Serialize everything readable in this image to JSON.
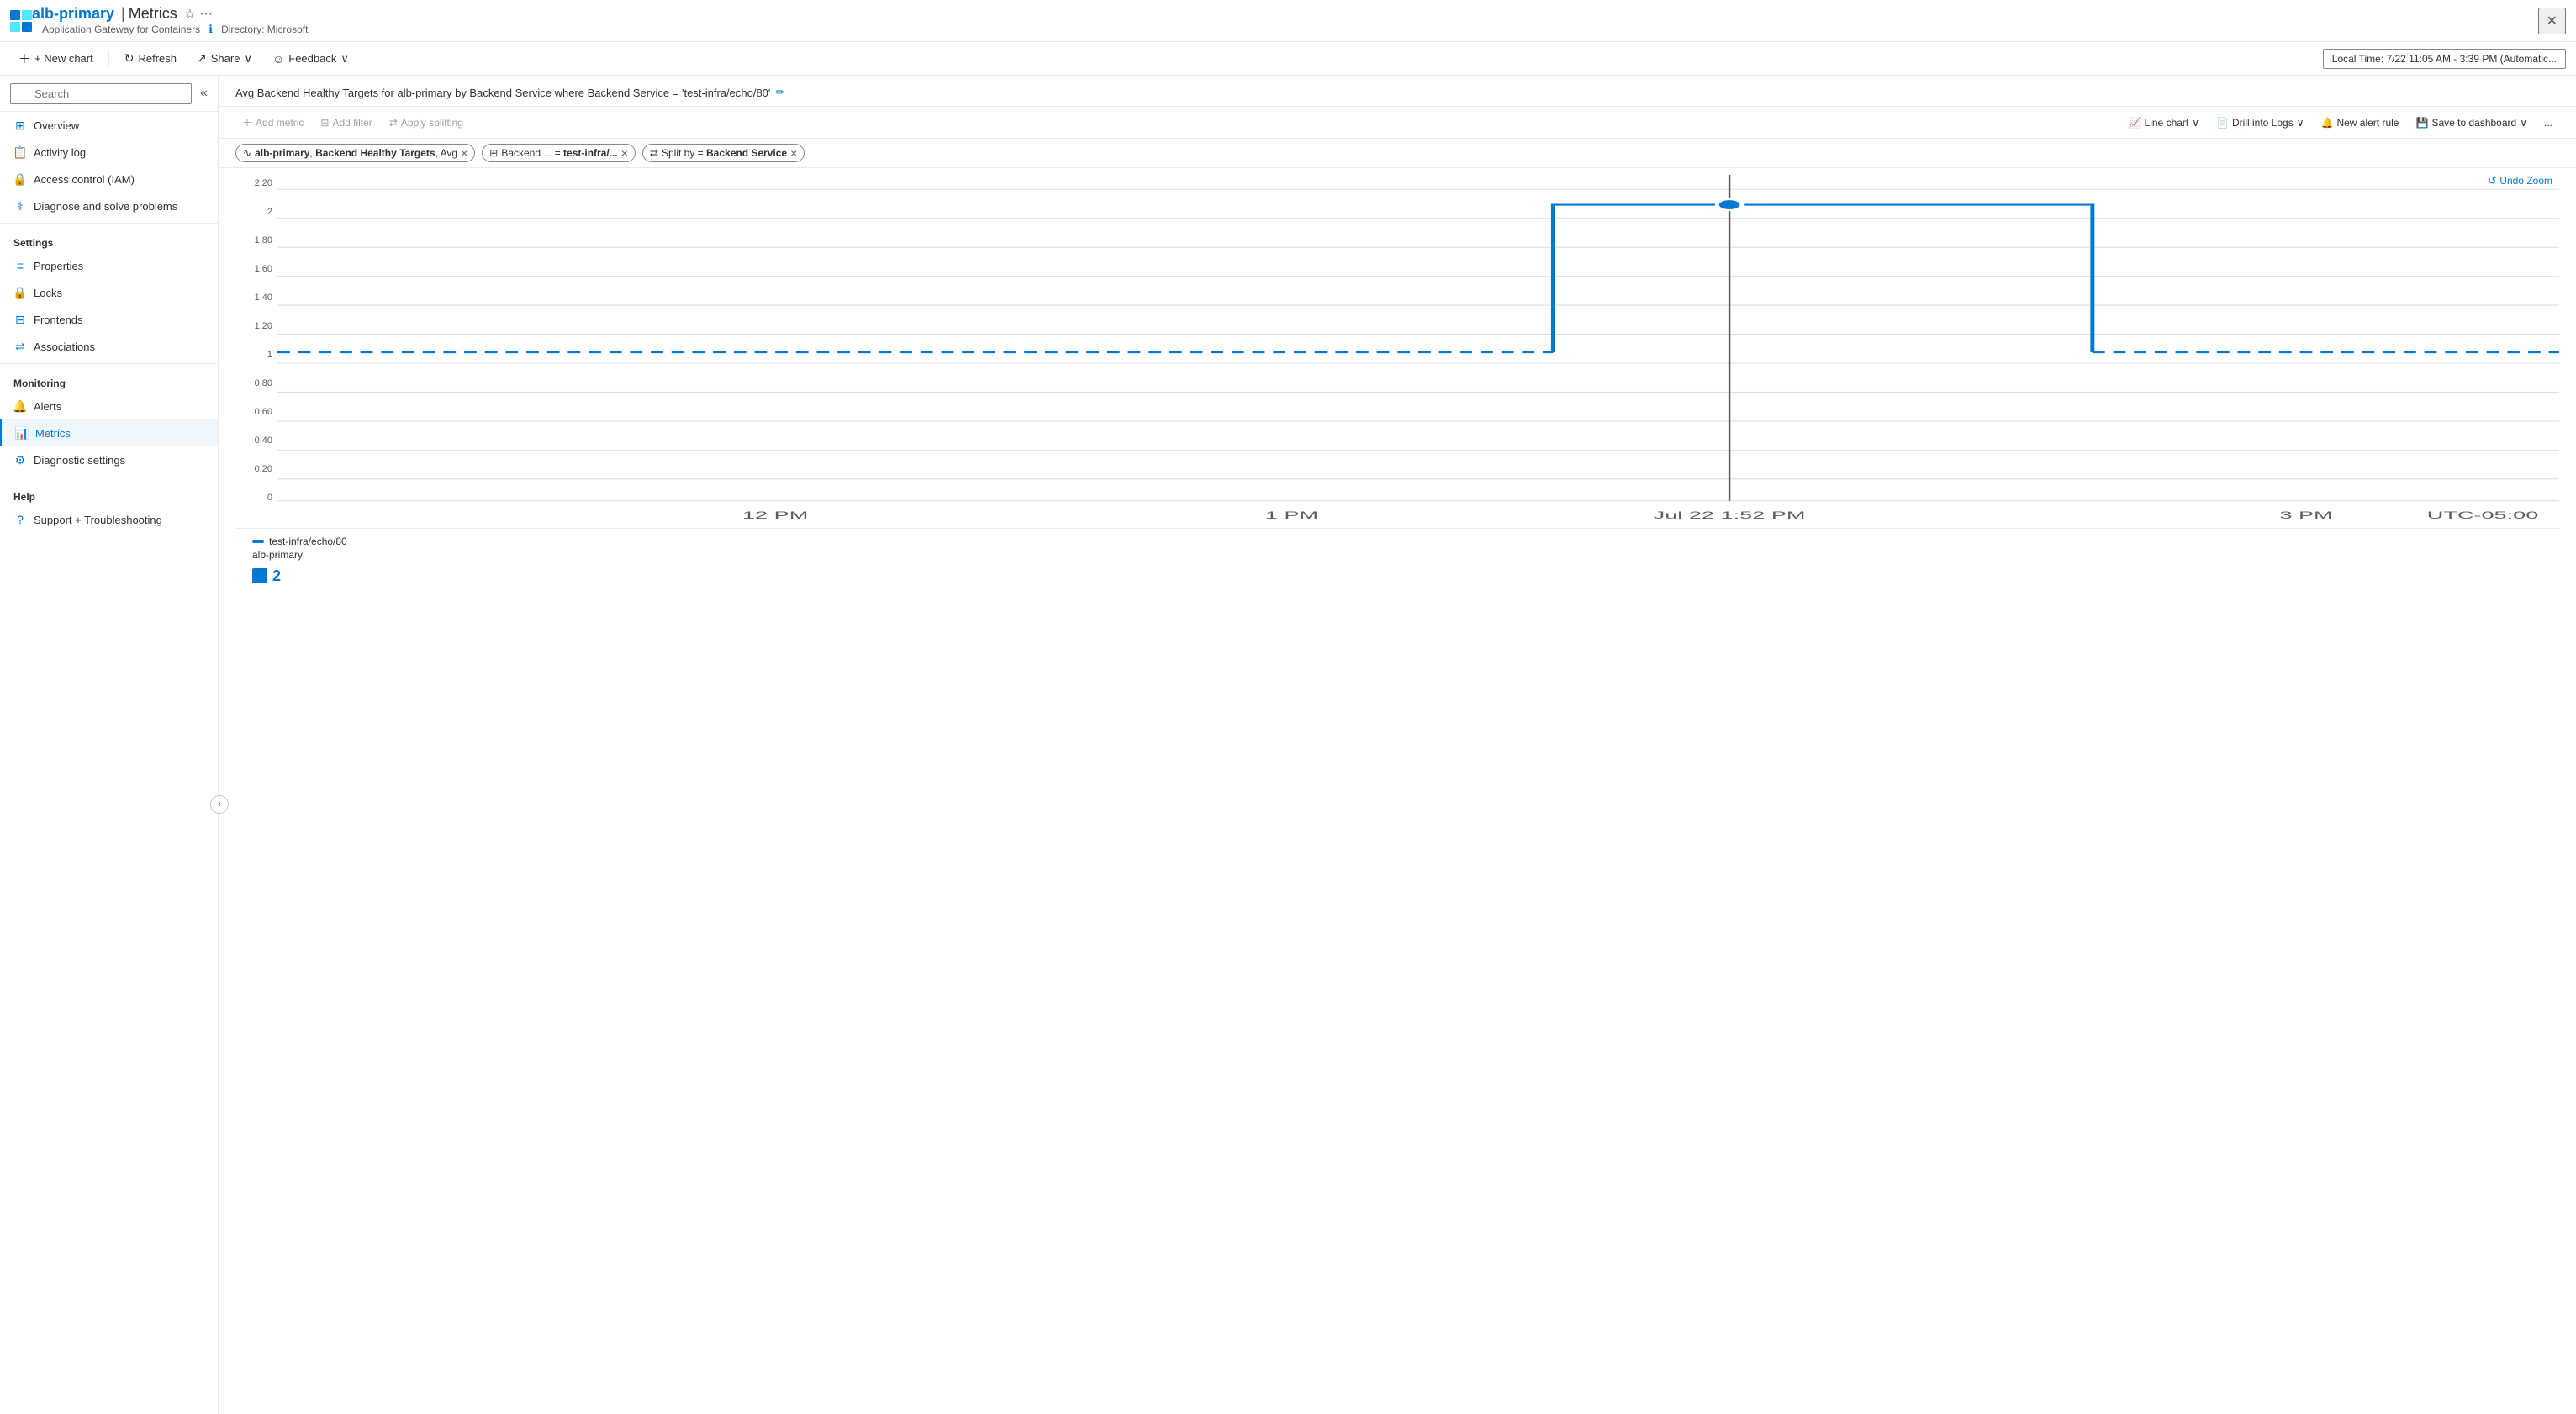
{
  "app": {
    "title": "alb-primary",
    "separator": "|",
    "page": "Metrics",
    "subtitle": "Application Gateway for Containers",
    "directory": "Directory: Microsoft"
  },
  "topbar": {
    "close_label": "✕"
  },
  "cmdbar": {
    "new_chart": "+ New chart",
    "refresh": "Refresh",
    "share": "Share",
    "feedback": "Feedback",
    "time_range": "Local Time: 7/22 11:05 AM - 3:39 PM (Automatic..."
  },
  "metrics": {
    "chart_title": "Avg Backend Healthy Targets for alb-primary by Backend Service where Backend Service = 'test-infra/echo/80'",
    "add_metric": "Add metric",
    "add_filter": "Add filter",
    "apply_splitting": "Apply splitting",
    "line_chart": "Line chart",
    "drill_into_logs": "Drill into Logs",
    "new_alert_rule": "New alert rule",
    "save_to_dashboard": "Save to dashboard",
    "more": "..."
  },
  "chips": [
    {
      "label": "alb-primary, Backend Healthy Targets, Avg",
      "has_close": true
    },
    {
      "label": "Backend ... = test-infra/...",
      "has_close": true
    },
    {
      "label": "Split by = Backend Service",
      "has_close": true
    }
  ],
  "undo_zoom": "Undo Zoom",
  "chart": {
    "y_labels": [
      "2.20",
      "2",
      "1.80",
      "1.60",
      "1.40",
      "1.20",
      "1",
      "0.80",
      "0.60",
      "0.40",
      "0.20",
      "0"
    ],
    "x_labels": [
      "12 PM",
      "1 PM",
      "Jul 22 1:52 PM",
      "3 PM",
      "UTC-05:00"
    ]
  },
  "legend": {
    "label1": "test-infra/echo/80",
    "label2": "alb-primary",
    "value": "2"
  },
  "sidebar": {
    "search_placeholder": "Search",
    "sections": [
      {
        "title": null,
        "items": [
          {
            "label": "Overview",
            "icon": "overview",
            "active": false
          },
          {
            "label": "Activity log",
            "icon": "activity",
            "active": false
          },
          {
            "label": "Access control (IAM)",
            "icon": "iam",
            "active": false
          },
          {
            "label": "Diagnose and solve problems",
            "icon": "diagnose",
            "active": false
          }
        ]
      },
      {
        "title": "Settings",
        "items": [
          {
            "label": "Properties",
            "icon": "properties",
            "active": false
          },
          {
            "label": "Locks",
            "icon": "locks",
            "active": false
          },
          {
            "label": "Frontends",
            "icon": "frontends",
            "active": false
          },
          {
            "label": "Associations",
            "icon": "associations",
            "active": false
          }
        ]
      },
      {
        "title": "Monitoring",
        "items": [
          {
            "label": "Alerts",
            "icon": "alerts",
            "active": false
          },
          {
            "label": "Metrics",
            "icon": "metrics",
            "active": true
          },
          {
            "label": "Diagnostic settings",
            "icon": "diagnostic",
            "active": false
          }
        ]
      },
      {
        "title": "Help",
        "items": [
          {
            "label": "Support + Troubleshooting",
            "icon": "support",
            "active": false
          }
        ]
      }
    ]
  }
}
